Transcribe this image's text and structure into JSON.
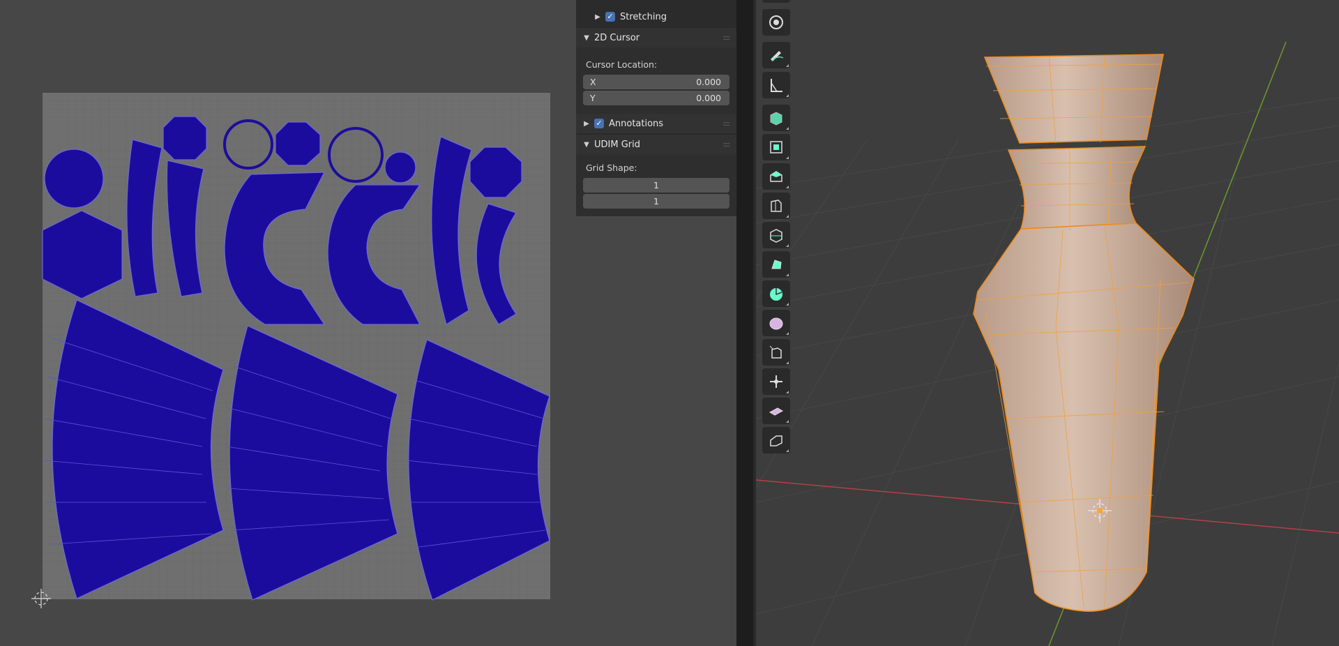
{
  "sidebar": {
    "stretching": {
      "label": "Stretching",
      "checked": true
    },
    "cursor_panel": {
      "title": "2D Cursor",
      "location_label": "Cursor Location:",
      "x_label": "X",
      "x_value": "0.000",
      "y_label": "Y",
      "y_value": "0.000"
    },
    "annotations": {
      "label": "Annotations",
      "checked": true
    },
    "udim_panel": {
      "title": "UDIM Grid",
      "grid_shape_label": "Grid Shape:",
      "grid_x": "1",
      "grid_y": "1"
    }
  },
  "toolbar": {
    "tools": [
      "transform-icon",
      "annotate-icon",
      "measure-icon",
      "add-cube-icon",
      "extrude-region-icon",
      "inset-faces-icon",
      "bevel-icon",
      "loop-cut-icon",
      "knife-icon",
      "poly-build-icon",
      "spin-icon",
      "smooth-icon",
      "edge-slide-icon",
      "shrink-fatten-icon",
      "shear-icon",
      "rip-region-icon"
    ]
  },
  "colors": {
    "uv_island": "#1a0a99",
    "selected_edge": "#ffa52e",
    "x_axis": "#b3404a",
    "y_axis": "#6a9a2a",
    "accent_checkbox": "#4772b3"
  }
}
